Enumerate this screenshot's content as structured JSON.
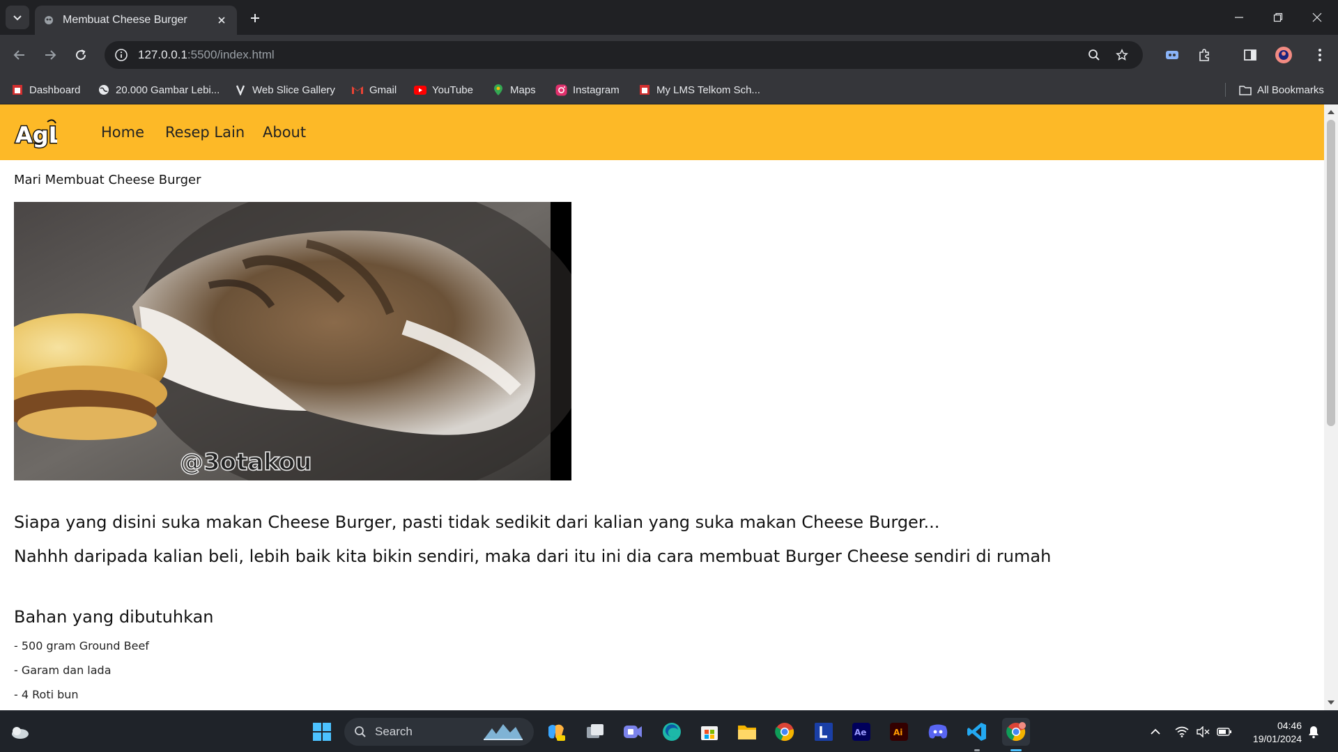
{
  "browser": {
    "tab_title": "Membuat Cheese Burger",
    "url_host": "127.0.0.1",
    "url_path": ":5500/index.html",
    "bookmarks": [
      {
        "label": "Dashboard",
        "icon": "lms-icon"
      },
      {
        "label": "20.000 Gambar Lebi...",
        "icon": "globe-icon"
      },
      {
        "label": "Web Slice Gallery",
        "icon": "web-slice-icon"
      },
      {
        "label": "Gmail",
        "icon": "gmail-icon"
      },
      {
        "label": "YouTube",
        "icon": "youtube-icon"
      },
      {
        "label": "Maps",
        "icon": "maps-icon"
      },
      {
        "label": "Instagram",
        "icon": "instagram-icon"
      },
      {
        "label": "My LMS Telkom Sch...",
        "icon": "lms-icon"
      }
    ],
    "all_bookmarks": "All Bookmarks"
  },
  "page": {
    "logo_text": "AgL",
    "nav": [
      "Home",
      "Resep Lain",
      "About"
    ],
    "heading": "Mari Membuat Cheese Burger",
    "image_watermark": "@3otakou",
    "intro": [
      "Siapa yang disini suka makan Cheese Burger, pasti tidak sedikit dari kalian yang suka makan Cheese Burger...",
      "Nahhh daripada kalian beli, lebih baik kita bikin sendiri, maka dari itu ini dia cara membuat Burger Cheese sendiri di rumah"
    ],
    "ingredients_heading": "Bahan yang dibutuhkan",
    "ingredients": [
      "- 500 gram Ground Beef",
      "- Garam dan lada",
      "- 4 Roti bun"
    ],
    "navbar_color": "#fdb927"
  },
  "taskbar": {
    "search_label": "Search",
    "time": "04:46",
    "date": "19/01/2024"
  }
}
